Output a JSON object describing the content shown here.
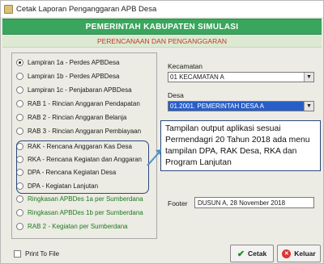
{
  "window": {
    "title": "Cetak Laporan Penganggaran APB Desa"
  },
  "header": {
    "title": "PEMERINTAH KABUPATEN SIMULASI",
    "subtitle": "PERENCANAAN DAN PENGANGGARAN"
  },
  "reports": [
    {
      "label": "Lampiran 1a - Perdes APBDesa",
      "checked": true,
      "green": false
    },
    {
      "label": "Lampiran 1b - Perdes APBDesa",
      "checked": false,
      "green": false
    },
    {
      "label": "Lampiran 1c - Penjabaran APBDesa",
      "checked": false,
      "green": false
    },
    {
      "label": "RAB 1 - Rincian Anggaran Pendapatan",
      "checked": false,
      "green": false
    },
    {
      "label": "RAB 2 - Rincian Anggaran Belanja",
      "checked": false,
      "green": false
    },
    {
      "label": "RAB 3 - Rincian Anggaran Pembiayaan",
      "checked": false,
      "green": false
    },
    {
      "label": "RAK - Rencana Anggaran Kas Desa",
      "checked": false,
      "green": false
    },
    {
      "label": "RKA - Rencana Kegiatan dan Anggaran",
      "checked": false,
      "green": false
    },
    {
      "label": "DPA - Rencana Kegiatan Desa",
      "checked": false,
      "green": false
    },
    {
      "label": "DPA - Kegiatan Lanjutan",
      "checked": false,
      "green": false
    },
    {
      "label": "Ringkasan APBDes 1a per Sumberdana",
      "checked": false,
      "green": true
    },
    {
      "label": "Ringkasan APBDes 1b per Sumberdana",
      "checked": false,
      "green": true
    },
    {
      "label": "RAB 2 - Kegiatan per Sumberdana",
      "checked": false,
      "green": true
    }
  ],
  "kecamatan": {
    "label": "Kecamatan",
    "value": "01  KECAMATAN A"
  },
  "desa": {
    "label": "Desa",
    "value": "01.2001.  PEMERINTAH DESA A"
  },
  "callout": {
    "text": "Tampilan output aplikasi sesuai Permendagri 20 Tahun 2018 ada menu tampilan DPA, RAK Desa, RKA dan Program Lanjutan"
  },
  "footer": {
    "label": "Footer",
    "value": "DUSUN A,  28 November 2018"
  },
  "print_to_file": {
    "label": "Print To File"
  },
  "buttons": {
    "print": "Cetak",
    "exit": "Keluar"
  },
  "colors": {
    "header_green": "#3aa65d",
    "subtitle_red": "#c0392b",
    "highlight_blue": "#2c4a7a"
  }
}
